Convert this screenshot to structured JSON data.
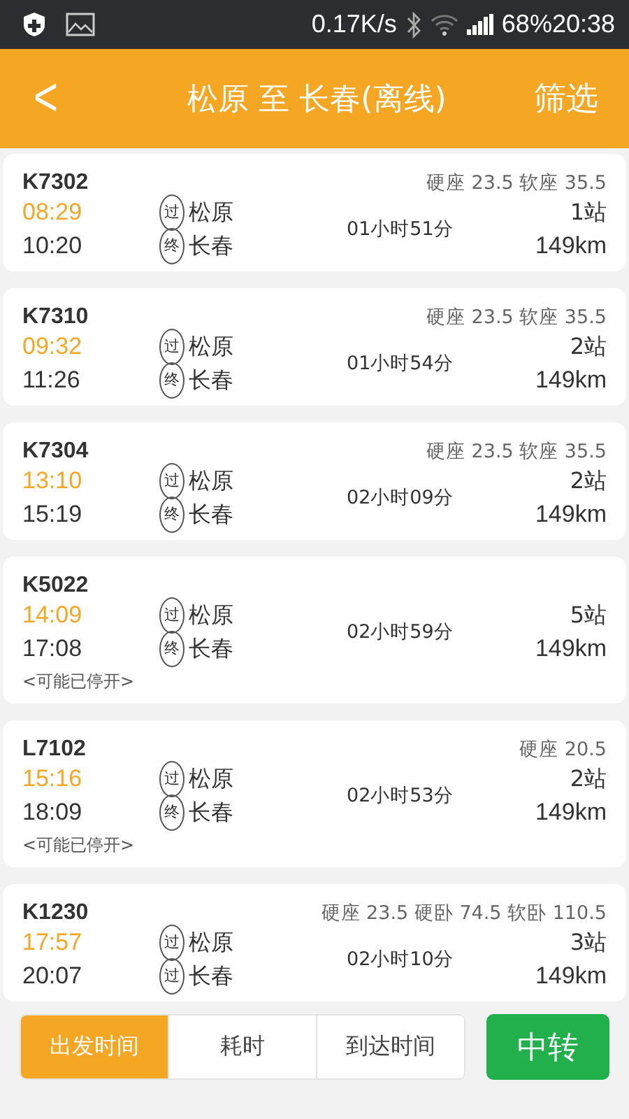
{
  "status_bar": {
    "speed": "0.17K/s",
    "battery": "68%",
    "time": "20:38"
  },
  "header": {
    "back": "<",
    "title": "松原 至 长春(离线)",
    "filter": "筛选"
  },
  "trains": [
    {
      "number": "K7302",
      "prices": "硬座 23.5 软座 35.5",
      "depart": "08:29",
      "arrive": "10:20",
      "from_mark": "过",
      "from": "松原",
      "to_mark": "终",
      "to": "长春",
      "duration": "01小时51分",
      "stops": "1站",
      "distance": "149km"
    },
    {
      "number": "K7310",
      "prices": "硬座 23.5 软座 35.5",
      "depart": "09:32",
      "arrive": "11:26",
      "from_mark": "过",
      "from": "松原",
      "to_mark": "终",
      "to": "长春",
      "duration": "01小时54分",
      "stops": "2站",
      "distance": "149km"
    },
    {
      "number": "K7304",
      "prices": "硬座 23.5 软座 35.5",
      "depart": "13:10",
      "arrive": "15:19",
      "from_mark": "过",
      "from": "松原",
      "to_mark": "终",
      "to": "长春",
      "duration": "02小时09分",
      "stops": "2站",
      "distance": "149km"
    },
    {
      "number": "K5022",
      "depart": "14:09",
      "arrive": "17:08",
      "from_mark": "过",
      "from": "松原",
      "to_mark": "终",
      "to": "长春",
      "duration": "02小时59分",
      "stops": "5站",
      "distance": "149km",
      "note": "<可能已停开>"
    },
    {
      "number": "L7102",
      "prices": "硬座 20.5",
      "depart": "15:16",
      "arrive": "18:09",
      "from_mark": "过",
      "from": "松原",
      "to_mark": "终",
      "to": "长春",
      "duration": "02小时53分",
      "stops": "2站",
      "distance": "149km",
      "note": "<可能已停开>"
    },
    {
      "number": "K1230",
      "prices": "硬座 23.5 硬卧 74.5 软卧 110.5",
      "depart": "17:57",
      "arrive": "20:07",
      "from_mark": "过",
      "from": "松原",
      "to_mark": "过",
      "to": "长春",
      "duration": "02小时10分",
      "stops": "3站",
      "distance": "149km"
    }
  ],
  "sort_tabs": [
    {
      "label": "出发时间",
      "selected": true
    },
    {
      "label": "耗时",
      "selected": false
    },
    {
      "label": "到达时间",
      "selected": false
    }
  ],
  "transfer_button": "中转"
}
